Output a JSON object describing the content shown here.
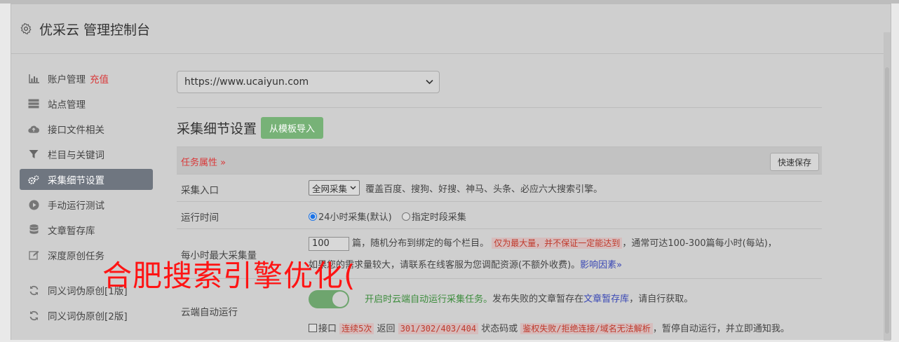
{
  "header": {
    "title": "优采云 管理控制台",
    "icon": "gear-icon"
  },
  "sidebar": {
    "items": [
      {
        "label": "账户管理",
        "extra": "充值",
        "icon": "bar-chart-icon"
      },
      {
        "label": "站点管理",
        "icon": "server-icon"
      },
      {
        "label": "接口文件相关",
        "icon": "cloud-upload-icon"
      },
      {
        "label": "栏目与关键词",
        "icon": "filter-icon"
      },
      {
        "label": "采集细节设置",
        "icon": "gears-icon",
        "active": true
      },
      {
        "label": "手动运行测试",
        "icon": "play-circle-icon"
      },
      {
        "label": "文章暂存库",
        "icon": "database-icon"
      },
      {
        "label": "深度原创任务",
        "icon": "edit-icon"
      },
      {
        "label": "同义词伪原创[1版]",
        "icon": "refresh-icon"
      },
      {
        "label": "同义词伪原创[2版]",
        "icon": "refresh-icon"
      }
    ]
  },
  "site_select": {
    "value": "https://www.ucaiyun.com"
  },
  "section": {
    "title": "采集细节设置",
    "import_button": "从模板导入"
  },
  "table": {
    "task_props": "任务属性 »",
    "quick_save": "快速保存",
    "rows": {
      "entry": {
        "label": "采集入口",
        "select_value": "全网采集",
        "desc": "覆盖百度、搜狗、好搜、神马、头条、必应六大搜索引擎。"
      },
      "time": {
        "label": "运行时间",
        "option1": "24小时采集(默认)",
        "option2": "指定时段采集"
      },
      "max": {
        "label": "每小时最大采集量",
        "value": "100",
        "text1": "篇，随机分布到绑定的每个栏目。",
        "warn": "仅为最大量，并不保证一定能达到",
        "text2": "，通常可达100-300篇每小时(每站)，",
        "text3": "如果您的需求量较大，请联系在线客服为您调配资源(不额外收费)。",
        "link": "影响因素»"
      },
      "cloud": {
        "label": "云端自动运行",
        "green_text": "开启时云端自动运行采集任务。",
        "text1": "发布失败的文章暂存在",
        "link": "文章暂存库",
        "text2": "，请自行获取。",
        "check_label": "接口",
        "badge1": "连续5次",
        "text3": "返回",
        "badge2": "301/302/403/404",
        "text4": "状态码或",
        "badge3": "鉴权失败/拒绝连接/域名无法解析",
        "text5": "，暂停自动运行，并立即通知我。"
      }
    }
  },
  "watermark": "合肥搜索引擎优化("
}
